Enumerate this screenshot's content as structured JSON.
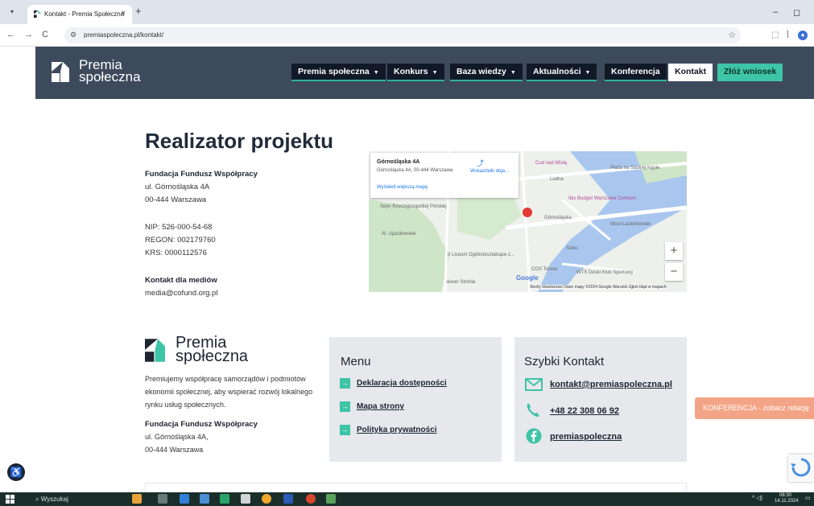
{
  "browser": {
    "tab_title": "Kontakt - Premia Społeczna",
    "tab_close": "×",
    "new_tab": "+",
    "url": "premiaspoleczna.pl/kontakt/",
    "nav_back": "←",
    "nav_forward": "→",
    "nav_reload": "C",
    "minimize": "–",
    "maximize": "◻"
  },
  "site_header": {
    "logo_line1": "Premia",
    "logo_line2": "społeczna",
    "nav": [
      {
        "label": "Premia społeczna",
        "caret": "▼"
      },
      {
        "label": "Konkurs",
        "caret": "▼"
      },
      {
        "label": "Baza wiedzy",
        "caret": "▼"
      },
      {
        "label": "Aktualności",
        "caret": "▼"
      },
      {
        "label": "Konferencja"
      },
      {
        "label": "Kontakt"
      },
      {
        "label": "Złóż wniosek"
      }
    ],
    "colors": {
      "header_bg": "#3d4a5c",
      "nav_bg": "#111827",
      "accent": "#3ec4a7"
    }
  },
  "main": {
    "title": "Realizator projektu",
    "org_name": "Fundacja Fundusz Współpracy",
    "street": "ul. Górnośląska 4A",
    "city": "00-444 Warszawa",
    "nip": "NIP: 526-000-54-68",
    "regon": "REGON: 002179760",
    "krs": "KRS: 0000112576",
    "media_label": "Kontakt dla mediów",
    "media_email": "media@cofund.org.pl"
  },
  "map": {
    "place_name": "Górnośląska 4A",
    "place_address": "Górnośląska 4A, 00-444 Warszawa",
    "directions": "Wskazówki doja...",
    "larger_map": "Wyświetl większą mapę",
    "labels": [
      "Cud nad Wisłą",
      "Plaża na Saskiej Kępie",
      "Ibis Budget Warszawa Centrum",
      "Sejm Rzeczypospolitej Polskiej",
      "Górnośląska",
      "Most Łazienkowski",
      "Al. Ujazdowskie",
      "II Liceum Ogólnokształcące z...",
      "COS Torwar",
      "WTS Deski Klub Sportowy",
      "skwer Strehla",
      "Solec",
      "Ludna"
    ],
    "attribution": "Skróty klawiszowe   Dane mapy ©2024 Google   Warunki   Zgłoś błąd w mapach",
    "google": "Google",
    "zoom_in": "+",
    "zoom_out": "−"
  },
  "footer": {
    "logo_line1": "Premia",
    "logo_line2": "społeczna",
    "desc_lines": [
      "Premiujemy współpracę samorządów i podmiotów",
      "ekonomii społecznej, aby wspierać rozwój lokalnego",
      "rynku usług społecznych."
    ],
    "org_name": "Fundacja Fundusz Współpracy",
    "street": "ul. Górnośląska 4A,",
    "city": "00-444 Warszawa",
    "menu_title": "Menu",
    "menu_items": [
      "Deklaracja dostępności",
      "Mapa strony",
      "Polityka prywatności"
    ],
    "contact_title": "Szybki Kontakt",
    "email": "kontakt@premiaspoleczna.pl",
    "phone": "+48 22 308 06 92",
    "facebook": "premiaspoleczna"
  },
  "conference_button": "KONFERENCJA - zobacz relację",
  "taskbar": {
    "search": "Wyszukaj",
    "time": "08:30",
    "date": "14.11.2024"
  }
}
